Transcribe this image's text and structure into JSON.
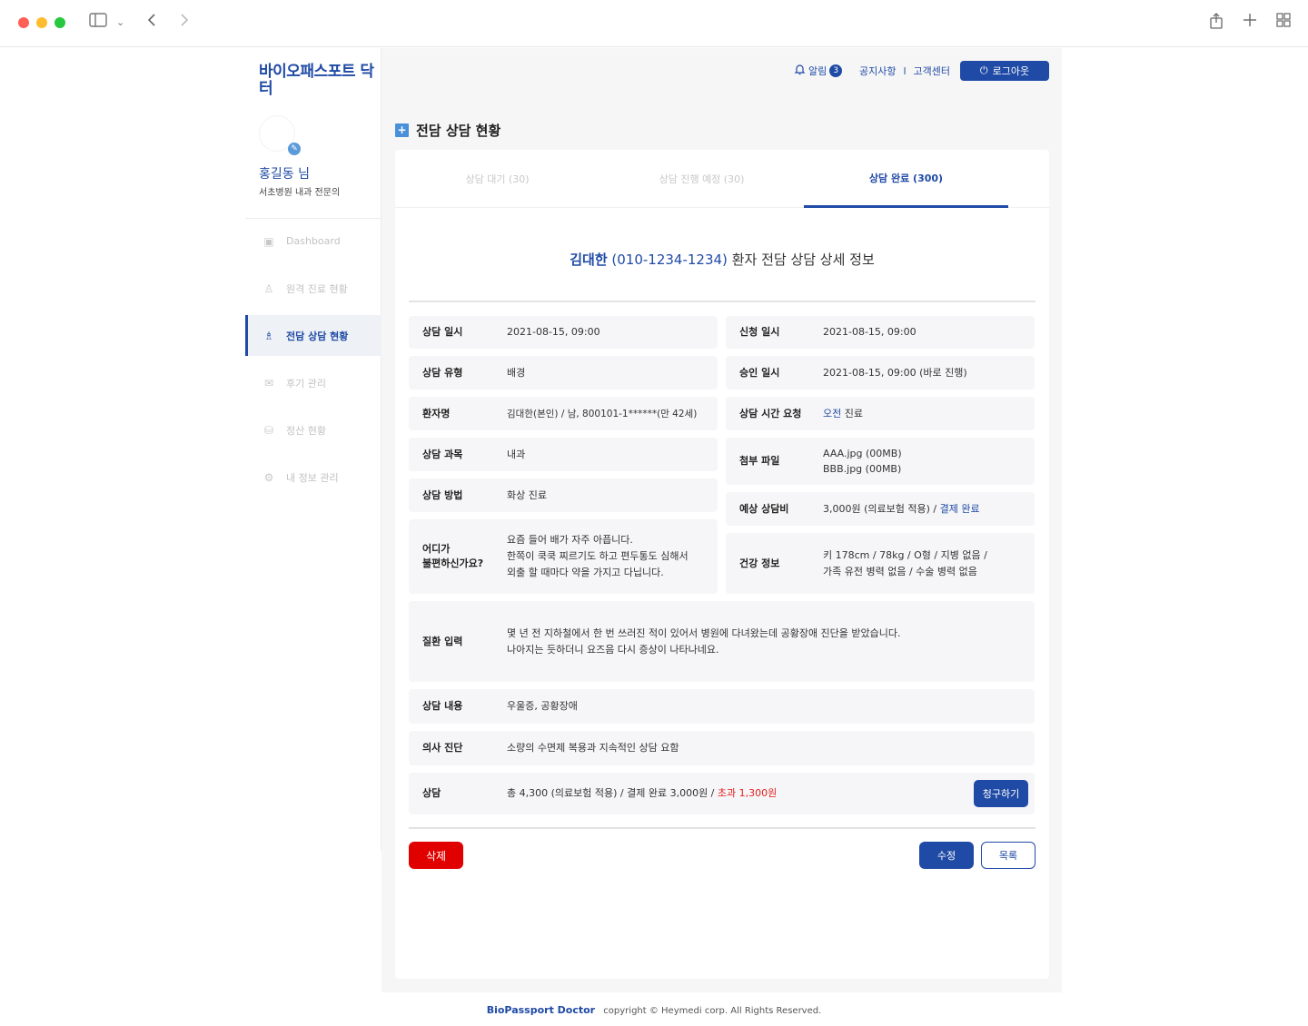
{
  "sidebar": {
    "logo": "바이오패스포트 닥터",
    "user_name": "홍길동 님",
    "user_role": "서초병원 내과 전문의",
    "menu": [
      {
        "label": "Dashboard",
        "icon": "dashboard-icon"
      },
      {
        "label": "원격 진료 현황",
        "icon": "remote-care-icon"
      },
      {
        "label": "전담 상담 현황",
        "icon": "consult-icon",
        "active": true
      },
      {
        "label": "후기 관리",
        "icon": "review-icon"
      },
      {
        "label": "정산 현황",
        "icon": "settlement-icon"
      },
      {
        "label": "내 정보 관리",
        "icon": "gear-icon"
      }
    ]
  },
  "topbar": {
    "alarm_label": "알림",
    "alarm_count": "3",
    "notice_label": "공지사항",
    "separator": "l",
    "support_label": "고객센터",
    "logout_label": "로그아웃"
  },
  "page": {
    "section_title": "전담 상담 현황",
    "tabs": [
      {
        "label": "상담 대기 (30)"
      },
      {
        "label": "상담 진행 예정 (30)"
      },
      {
        "label": "상담 완료 (300)",
        "active": true
      }
    ],
    "detail": {
      "patient_name": "김대한",
      "patient_phone": "(010-1234-1234)",
      "title_suffix": "환자 전담 상담 상세 정보"
    }
  },
  "info": {
    "consult_datetime": {
      "label": "상담 일시",
      "value": "2021-08-15, 09:00"
    },
    "consult_type": {
      "label": "상담 유형",
      "value": "배경"
    },
    "patient": {
      "label": "환자명",
      "value": "김대한(본인) / 남, 800101-1******(만 42세)"
    },
    "department": {
      "label": "상담 과목",
      "value": "내과"
    },
    "method": {
      "label": "상담 방법",
      "value": "화상 진료"
    },
    "symptom": {
      "label_line1": "어디가",
      "label_line2": "불편하신가요?",
      "lines": [
        "요즘 들어 배가 자주 아픕니다.",
        "한쪽이 쿡쿡 찌르기도 하고 편두통도 심해서",
        "외출 할 때마다 약을 가지고 다닙니다."
      ]
    },
    "apply_datetime": {
      "label": "신청 일시",
      "value": "2021-08-15, 09:00"
    },
    "approve_datetime": {
      "label": "승인 일시",
      "value": "2021-08-15, 09:00 (바로 진행)"
    },
    "time_request": {
      "label": "상담 시간 요청",
      "value_highlight": "오전",
      "value_rest": " 진료"
    },
    "attachments": {
      "label": "첨부 파일",
      "files": [
        "AAA.jpg (00MB)",
        "BBB.jpg (00MB)"
      ]
    },
    "expected_fee": {
      "label": "예상 상담비",
      "value": "3,000원 (의료보험 적용) / ",
      "status": "결제 완료"
    },
    "health": {
      "label": "건강 정보",
      "lines": [
        "키 178cm / 78kg / O형 / 지병 없음 /",
        "가족 유전 병력 없음 / 수술 병력 없음"
      ]
    },
    "disease": {
      "label": "질환 입력",
      "lines": [
        "몇 년 전 지하철에서 한 번 쓰러진 적이 있어서 병원에 다녀왔는데 공황장애 진단을 받았습니다.",
        "나아지는 듯하더니 요즈음 다시 증상이 나타나네요."
      ]
    },
    "content": {
      "label": "상담 내용",
      "value": "우울증, 공황장애"
    },
    "diagnosis": {
      "label": "의사 진단",
      "value": "소량의 수면제 복용과 지속적인 상담 요함"
    },
    "billing": {
      "label": "상담",
      "value": "총 4,300 (의료보험 적용) / 결제 완료 3,000원 / ",
      "excess": "초과 1,300원",
      "button": "청구하기"
    }
  },
  "actions": {
    "delete": "삭제",
    "edit": "수정",
    "list": "목록"
  },
  "footer": {
    "brand": "BioPassport Doctor",
    "copyright": "copyright © Heymedi corp. All Rights Reserved."
  },
  "colors": {
    "brand": "#1f4aa5",
    "danger": "#e00000",
    "cell_bg": "#f6f6f8"
  }
}
